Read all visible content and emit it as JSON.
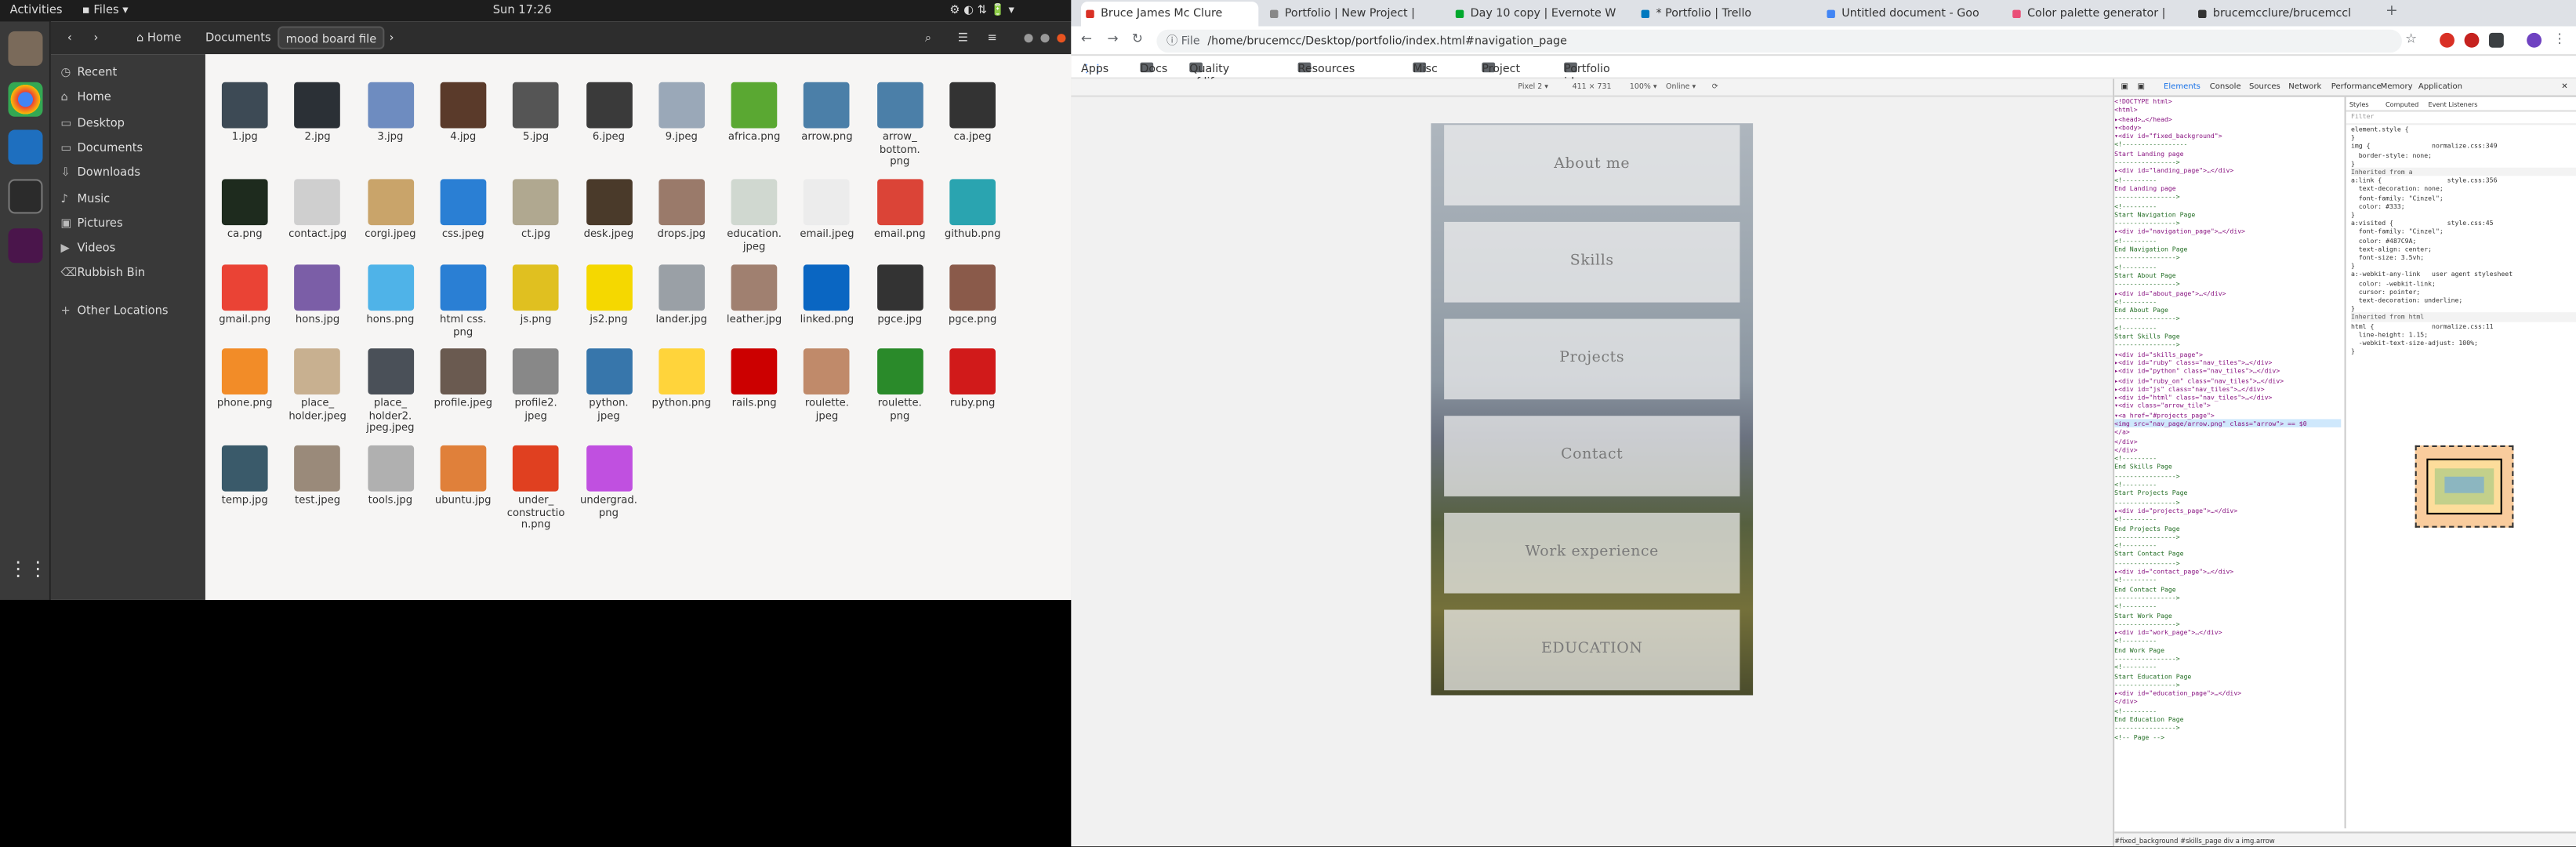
{
  "topbar": {
    "activities": "Activities",
    "app": "Files",
    "clock": "Sun 17:26"
  },
  "files": {
    "path": [
      "Home",
      "Documents",
      "mood board file"
    ],
    "sidebar": [
      {
        "label": "Recent",
        "icon": "clock-icon"
      },
      {
        "label": "Home",
        "icon": "home-icon"
      },
      {
        "label": "Desktop",
        "icon": "folder-icon"
      },
      {
        "label": "Documents",
        "icon": "folder-icon"
      },
      {
        "label": "Downloads",
        "icon": "download-icon"
      },
      {
        "label": "Music",
        "icon": "music-icon"
      },
      {
        "label": "Pictures",
        "icon": "picture-icon"
      },
      {
        "label": "Videos",
        "icon": "video-icon"
      },
      {
        "label": "Rubbish Bin",
        "icon": "trash-icon"
      },
      {
        "label": "Other Locations",
        "icon": "plus-icon"
      }
    ],
    "items": [
      {
        "name": "1.jpg",
        "color": "#3d4a55"
      },
      {
        "name": "2.jpg",
        "color": "#2b3036"
      },
      {
        "name": "3.jpg",
        "color": "#6e8cc0"
      },
      {
        "name": "4.jpg",
        "color": "#5a3a2a"
      },
      {
        "name": "5.jpg",
        "color": "#555555"
      },
      {
        "name": "6.jpeg",
        "color": "#3a3a3a"
      },
      {
        "name": "9.jpeg",
        "color": "#9aa8b8"
      },
      {
        "name": "africa.png",
        "color": "#5aa832"
      },
      {
        "name": "arrow.png",
        "color": "#4b7fa8"
      },
      {
        "name": "arrow_\nbottom.\npng",
        "color": "#4b7fa8"
      },
      {
        "name": "ca.jpeg",
        "color": "#333333"
      },
      {
        "name": "ca.png",
        "color": "#1e2b1e"
      },
      {
        "name": "contact.jpg",
        "color": "#cfcfcf"
      },
      {
        "name": "corgi.jpeg",
        "color": "#c9a46a"
      },
      {
        "name": "css.jpeg",
        "color": "#2a7fd4"
      },
      {
        "name": "ct.jpg",
        "color": "#b0a890"
      },
      {
        "name": "desk.jpeg",
        "color": "#4a3a2a"
      },
      {
        "name": "drops.jpg",
        "color": "#9a7a6a"
      },
      {
        "name": "education.\njpeg",
        "color": "#d0d8d0"
      },
      {
        "name": "email.jpeg",
        "color": "#ececec"
      },
      {
        "name": "email.png",
        "color": "#db4437"
      },
      {
        "name": "github.png",
        "color": "#2aa4b0"
      },
      {
        "name": "gmail.png",
        "color": "#ea4335"
      },
      {
        "name": "hons.jpg",
        "color": "#7b5ea7"
      },
      {
        "name": "hons.png",
        "color": "#4fb3e8"
      },
      {
        "name": "html css.\npng",
        "color": "#2a7fd4"
      },
      {
        "name": "js.png",
        "color": "#e0c020"
      },
      {
        "name": "js2.png",
        "color": "#f5d800"
      },
      {
        "name": "lander.jpg",
        "color": "#9aa0a6"
      },
      {
        "name": "leather.jpg",
        "color": "#a08070"
      },
      {
        "name": "linked.png",
        "color": "#0a66c2"
      },
      {
        "name": "pgce.jpg",
        "color": "#333333"
      },
      {
        "name": "pgce.png",
        "color": "#8a5a4a"
      },
      {
        "name": "phone.png",
        "color": "#f28c28"
      },
      {
        "name": "place_\nholder.jpeg",
        "color": "#c8b090"
      },
      {
        "name": "place_\nholder2.\njpeg.jpeg",
        "color": "#4a5058"
      },
      {
        "name": "profile.jpeg",
        "color": "#6a5a50"
      },
      {
        "name": "profile2.\njpeg",
        "color": "#888888"
      },
      {
        "name": "python.\njpeg",
        "color": "#3776ab"
      },
      {
        "name": "python.png",
        "color": "#ffd43b"
      },
      {
        "name": "rails.png",
        "color": "#cc0000"
      },
      {
        "name": "roulette.\njpeg",
        "color": "#c08a6a"
      },
      {
        "name": "roulette.\npng",
        "color": "#2a8a2a"
      },
      {
        "name": "ruby.png",
        "color": "#d11a1a"
      },
      {
        "name": "temp.jpg",
        "color": "#3a5a6a"
      },
      {
        "name": "test.jpeg",
        "color": "#9a8a7a"
      },
      {
        "name": "tools.jpg",
        "color": "#b0b0b0"
      },
      {
        "name": "ubuntu.jpg",
        "color": "#e0803a"
      },
      {
        "name": "under_\nconstructio\nn.png",
        "color": "#e04020"
      },
      {
        "name": "undergrad.\npng",
        "color": "#c050e0"
      }
    ]
  },
  "chrome": {
    "tabs": [
      "Bruce James Mc Clure",
      "Portfolio | New Project |",
      "Day 10 copy | Evernote W",
      "* Portfolio | Trello",
      "Untitled document - Goo",
      "Color palette generator |",
      "brucemcclure/brucemccl"
    ],
    "url_prefix": "File",
    "url": "/home/brucemcc/Desktop/portfolio/index.html#navigation_page",
    "bookmarks": [
      "Apps",
      "Docs",
      "Quality of life",
      "Resources",
      "Misc",
      "Project manag...",
      "Portfolio ideas"
    ],
    "device": "Pixel 2 ▾",
    "dims": "411 × 731",
    "zoom": "100% ▾",
    "network": "Online ▾",
    "nav": [
      "About me",
      "Skills",
      "Projects",
      "Contact",
      "Work experience",
      "EDUCATION"
    ]
  },
  "devtools": {
    "tabs": [
      "Elements",
      "Console",
      "Sources",
      "Network",
      "Performance",
      "Memory",
      "Application"
    ],
    "style_tabs": [
      "Styles",
      "Computed",
      "Event Listeners"
    ],
    "filter": "Filter",
    "elements": [
      "<!DOCTYPE html>",
      "<html>",
      "  ▸<head>…</head>",
      "  ▾<body>",
      "    ▾<div id=\"fixed_background\">",
      "      <!-----------------",
      "      Start Landing page",
      "      ---------------->",
      "      ▸<div id=\"landing_page\">…</div>",
      "      <!---------",
      "      End Landing page",
      "      ---------------->",
      "      <!---------",
      "      Start Navigation Page",
      "      ---------------->",
      "      ▸<div id=\"navigation_page\">…</div>",
      "      <!---------",
      "      End Navigation Page",
      "      ---------------->",
      "      <!---------",
      "      Start About Page",
      "      ---------------->",
      "      ▸<div id=\"about_page\">…</div>",
      "      <!---------",
      "      End About Page",
      "      ---------------->",
      "      <!---------",
      "      Start Skills Page",
      "      ---------------->",
      "      ▾<div id=\"skills_page\">",
      "        ▸<div id=\"ruby\" class=\"nav_tiles\">…</div>",
      "        ▸<div id=\"python\" class=\"nav_tiles\">…</div>",
      "        ▸<div id=\"ruby_on\" class=\"nav_tiles\">…</div>",
      "        ▸<div id=\"js\" class=\"nav_tiles\">…</div>",
      "        ▸<div id=\"html\" class=\"nav_tiles\">…</div>",
      "        ▾<div class=\"arrow_tile\">",
      "          ▾<a href=\"#projects_page\">",
      "            <img src=\"nav_page/arrow.png\" class=\"arrow\"> == $0",
      "          </a>",
      "        </div>",
      "      </div>",
      "      <!---------",
      "      End Skills Page",
      "      ---------------->",
      "      <!---------",
      "      Start Projects Page",
      "      ---------------->",
      "      ▸<div id=\"projects_page\">…</div>",
      "      <!---------",
      "      End Projects Page",
      "      ---------------->",
      "      <!---------",
      "      Start Contact Page",
      "      ---------------->",
      "      ▸<div id=\"contact_page\">…</div>",
      "      <!---------",
      "      End Contact Page",
      "      ---------------->",
      "      <!---------",
      "      Start Work Page",
      "      ---------------->",
      "      ▸<div id=\"work_page\">…</div>",
      "      <!---------",
      "      End Work Page",
      "      ---------------->",
      "      <!---------",
      "      Start Education Page",
      "      ---------------->",
      "      ▸<div id=\"education_page\">…</div>",
      "      </div>",
      "      <!---------",
      "      End Education Page",
      "      ---------------->",
      "      <!-- Page -->"
    ],
    "styles": [
      "element.style {",
      "}",
      "img {                normalize.css:349",
      "  border-style: none;",
      "}",
      "Inherited from a",
      "a:link {                 style.css:356",
      "  text-decoration: none;",
      "  font-family: \"Cinzel\";",
      "  color: #333;",
      "}",
      "a:visited {              style.css:45",
      "  font-family: \"Cinzel\";",
      "  color: #487C9A;",
      "  text-align: center;",
      "  font-size: 3.5vh;",
      "}",
      "a:-webkit-any-link   user agent stylesheet",
      "  color: -webkit-link;",
      "  cursor: pointer;",
      "  text-decoration: underline;",
      "}",
      "Inherited from html",
      "html {               normalize.css:11",
      "  line-height: 1.15;",
      "  -webkit-text-size-adjust: 100%;",
      "}"
    ],
    "crumbs": "#fixed_background  #skills_page  div  a  img.arrow"
  }
}
